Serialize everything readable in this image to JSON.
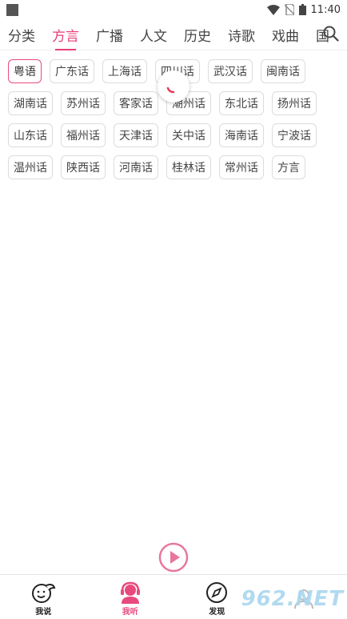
{
  "status": {
    "time": "11:40"
  },
  "tabs": [
    {
      "label": "分类",
      "active": false
    },
    {
      "label": "方言",
      "active": true
    },
    {
      "label": "广播",
      "active": false
    },
    {
      "label": "人文",
      "active": false
    },
    {
      "label": "历史",
      "active": false
    },
    {
      "label": "诗歌",
      "active": false
    },
    {
      "label": "戏曲",
      "active": false
    },
    {
      "label": "国",
      "active": false
    }
  ],
  "chips": [
    "粤语",
    "广东话",
    "上海话",
    "四川话",
    "武汉话",
    "闽南话",
    "湖南话",
    "苏州话",
    "客家话",
    "潮州话",
    "东北话",
    "扬州话",
    "山东话",
    "福州话",
    "天津话",
    "关中话",
    "海南话",
    "宁波话",
    "温州话",
    "陕西话",
    "河南话",
    "桂林话",
    "常州话",
    "方言"
  ],
  "selected_chip": "粤语",
  "bottom_nav": [
    {
      "label": "我说",
      "icon": "face-icon"
    },
    {
      "label": "我听",
      "icon": "listener-icon"
    },
    {
      "label": "发现",
      "icon": "compass-icon"
    },
    {
      "label": "",
      "icon": "profile-icon"
    }
  ],
  "watermark": "962.NET",
  "colors": {
    "accent": "#e84a7e",
    "text": "#444444"
  }
}
